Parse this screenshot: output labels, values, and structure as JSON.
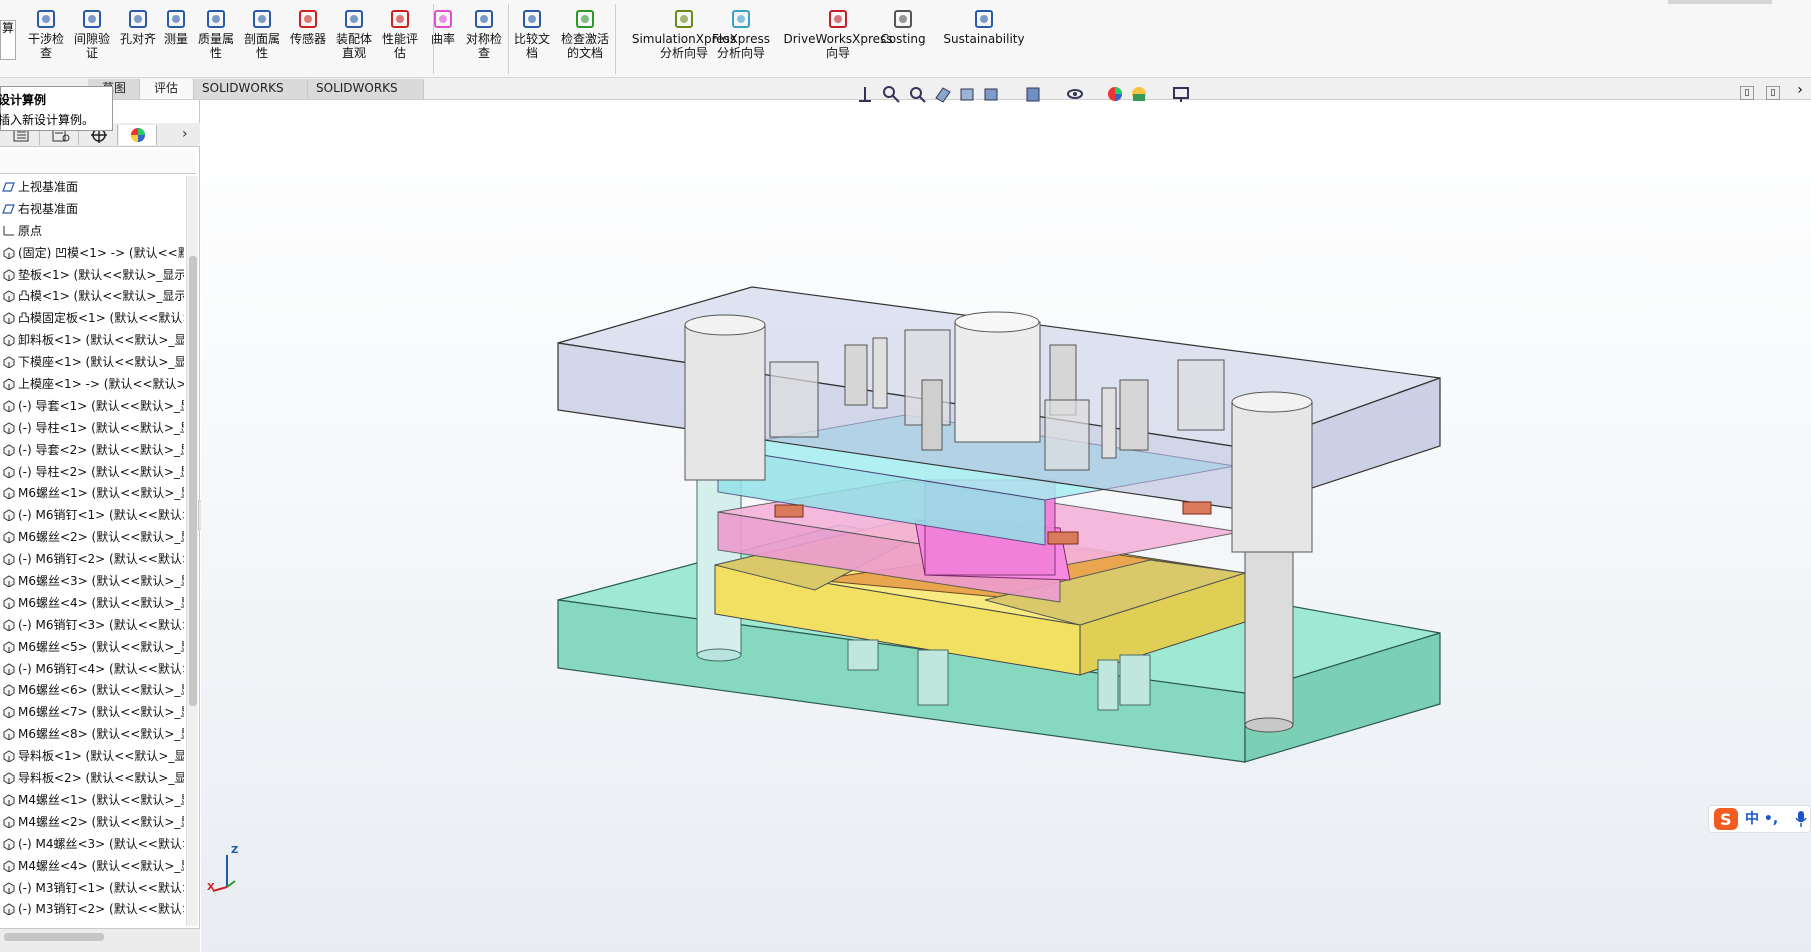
{
  "ribbon": {
    "items": [
      {
        "name": "interference-check",
        "label": "干涉检\n查"
      },
      {
        "name": "clearance-verify",
        "label": "间隙验\n证"
      },
      {
        "name": "hole-align",
        "label": "孔对齐"
      },
      {
        "name": "measure",
        "label": "测量"
      },
      {
        "name": "mass-props",
        "label": "质量属\n性"
      },
      {
        "name": "section-props",
        "label": "剖面属\n性"
      },
      {
        "name": "sensor",
        "label": "传感器"
      },
      {
        "name": "assembly-visualization",
        "label": "装配体\n直观"
      },
      {
        "name": "performance-eval",
        "label": "性能评\n估"
      },
      {
        "name": "curvature",
        "label": "曲率"
      },
      {
        "name": "symmetry-check",
        "label": "对称检\n查"
      },
      {
        "name": "compare-docs",
        "label": "比较文\n档"
      },
      {
        "name": "check-active-doc",
        "label": "检查激活\n的文档"
      },
      {
        "name": "simulationxpress",
        "label": "SimulationXpress\n分析向导"
      },
      {
        "name": "floxpress",
        "label": "FloXpress\n分析向导"
      },
      {
        "name": "driveworksxpress",
        "label": "DriveWorksXpress\n向导"
      },
      {
        "name": "costing",
        "label": "Costing"
      },
      {
        "name": "sustainability",
        "label": "Sustainability"
      }
    ],
    "left_fragment": "算"
  },
  "tabs": [
    {
      "label": "评估"
    },
    {
      "label": "SOLIDWORKS 插件"
    },
    {
      "label": "SOLIDWORKS MBD"
    }
  ],
  "tab_fragments": {
    "a": "草图"
  },
  "tooltip": {
    "title": "设计算例",
    "desc": "插入新设计算例。"
  },
  "tree": {
    "items": [
      {
        "label": "上视基准面",
        "icon": "plane-icon"
      },
      {
        "label": "右视基准面",
        "icon": "plane-icon"
      },
      {
        "label": "原点",
        "icon": "origin-icon"
      },
      {
        "label": "(固定) 凹模<1> -> (默认<<默",
        "icon": "part-icon"
      },
      {
        "label": "垫板<1> (默认<<默认>_显示",
        "icon": "part-icon"
      },
      {
        "label": "凸模<1> (默认<<默认>_显示",
        "icon": "part-icon"
      },
      {
        "label": "凸模固定板<1> (默认<<默认>",
        "icon": "part-icon"
      },
      {
        "label": "卸料板<1> (默认<<默认>_显",
        "icon": "part-icon"
      },
      {
        "label": "下模座<1> (默认<<默认>_显",
        "icon": "part-icon"
      },
      {
        "label": "上模座<1> -> (默认<<默认>_",
        "icon": "part-icon"
      },
      {
        "label": "(-) 导套<1> (默认<<默认>_显",
        "icon": "part-icon"
      },
      {
        "label": "(-) 导柱<1> (默认<<默认>_显",
        "icon": "part-icon"
      },
      {
        "label": "(-) 导套<2> (默认<<默认>_显",
        "icon": "part-icon"
      },
      {
        "label": "(-) 导柱<2> (默认<<默认>_显",
        "icon": "part-icon"
      },
      {
        "label": "M6螺丝<1> (默认<<默认>_显",
        "icon": "part-icon"
      },
      {
        "label": "(-) M6销钉<1> (默认<<默认>",
        "icon": "part-icon"
      },
      {
        "label": "M6螺丝<2> (默认<<默认>_显",
        "icon": "part-icon"
      },
      {
        "label": "(-) M6销钉<2> (默认<<默认>",
        "icon": "part-icon"
      },
      {
        "label": "M6螺丝<3> (默认<<默认>_显",
        "icon": "part-icon"
      },
      {
        "label": "M6螺丝<4> (默认<<默认>_显",
        "icon": "part-icon"
      },
      {
        "label": "(-) M6销钉<3> (默认<<默认>",
        "icon": "part-icon"
      },
      {
        "label": "M6螺丝<5> (默认<<默认>_显",
        "icon": "part-icon"
      },
      {
        "label": "(-) M6销钉<4> (默认<<默认>",
        "icon": "part-icon"
      },
      {
        "label": "M6螺丝<6> (默认<<默认>_显",
        "icon": "part-icon"
      },
      {
        "label": "M6螺丝<7> (默认<<默认>_显",
        "icon": "part-icon"
      },
      {
        "label": "M6螺丝<8> (默认<<默认>_显",
        "icon": "part-icon"
      },
      {
        "label": "导料板<1> (默认<<默认>_显示",
        "icon": "part-icon"
      },
      {
        "label": "导料板<2> (默认<<默认>_显示",
        "icon": "part-icon"
      },
      {
        "label": "M4螺丝<1> (默认<<默认>_显",
        "icon": "part-icon"
      },
      {
        "label": "M4螺丝<2> (默认<<默认>_显",
        "icon": "part-icon"
      },
      {
        "label": "(-) M4螺丝<3> (默认<<默认>",
        "icon": "part-icon"
      },
      {
        "label": "M4螺丝<4> (默认<<默认>_显",
        "icon": "part-icon"
      },
      {
        "label": "(-) M3销钉<1> (默认<<默认>",
        "icon": "part-icon"
      },
      {
        "label": "(-) M3销钉<2> (默认<<默认>",
        "icon": "part-icon"
      }
    ]
  },
  "ime": {
    "label": "中 •,"
  },
  "triad": {
    "z": "Z",
    "x": "X"
  },
  "colors": {
    "top_plate": "#b9bfd9",
    "punch_plate": "#9fe8ee",
    "stripper": "#f3a7d6",
    "die": "#f5e46a",
    "bottom_plate": "#8fe3c9",
    "punch": "#f58ae0",
    "orange": "#e8a24a"
  }
}
